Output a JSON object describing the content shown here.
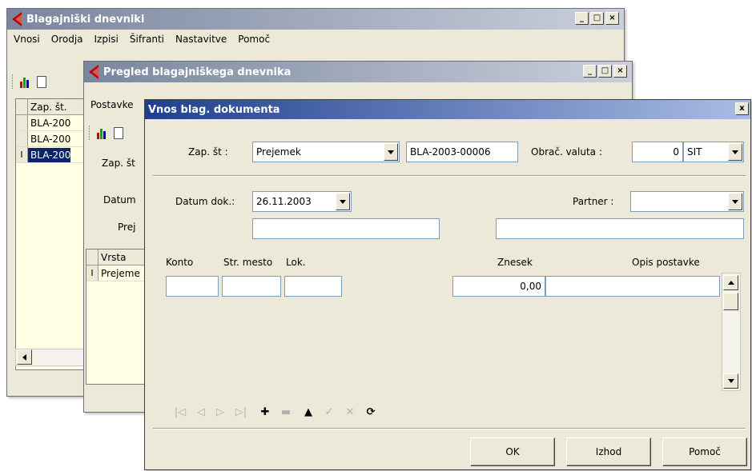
{
  "win1": {
    "title": "Blagajniški dnevniki",
    "menu": [
      "Vnosi",
      "Orodja",
      "Izpisi",
      "Šifranti",
      "Nastavitve",
      "Pomoč"
    ],
    "grid_header": "Zap. št.",
    "rows": [
      "BLA-200",
      "BLA-200",
      "BLA-200"
    ],
    "row_marker": "I"
  },
  "win2": {
    "title": "Pregled blagajniškega dnevnika",
    "menu": [
      "Postavke"
    ],
    "zap_label": "Zap. št",
    "datum_label": "Datum",
    "prej_label": "Prej",
    "grid_header": "Vrsta",
    "row": "Prejeme",
    "row_marker": "I"
  },
  "dialog": {
    "title": "Vnos blag. dokumenta",
    "close": "x",
    "zap_label": "Zap. št :",
    "zap_type": "Prejemek",
    "zap_number": "BLA-2003-00006",
    "valuta_label": "Obrač. valuta :",
    "valuta_amount": "0",
    "valuta_code": "SIT",
    "datum_label": "Datum dok.:",
    "datum_value": "26.11.2003",
    "partner_label": "Partner :",
    "partner_value": "",
    "col_konto": "Konto",
    "col_strmesto": "Str. mesto",
    "col_lok": "Lok.",
    "col_znesek": "Znesek",
    "col_opis": "Opis postavke",
    "znesek_value": "0,00",
    "buttons": {
      "ok": "OK",
      "exit": "Izhod",
      "help": "Pomoč"
    },
    "navigator": [
      "|◁",
      "◁",
      "▷",
      "▷|",
      "✚",
      "▬",
      "▲",
      "✓",
      "✕",
      "⟳"
    ]
  },
  "colors": {
    "active_title": "#1f3f8f",
    "inactive_title": "#7a869e",
    "selection": "#0a246a",
    "grid_bg": "#ffffe4"
  }
}
